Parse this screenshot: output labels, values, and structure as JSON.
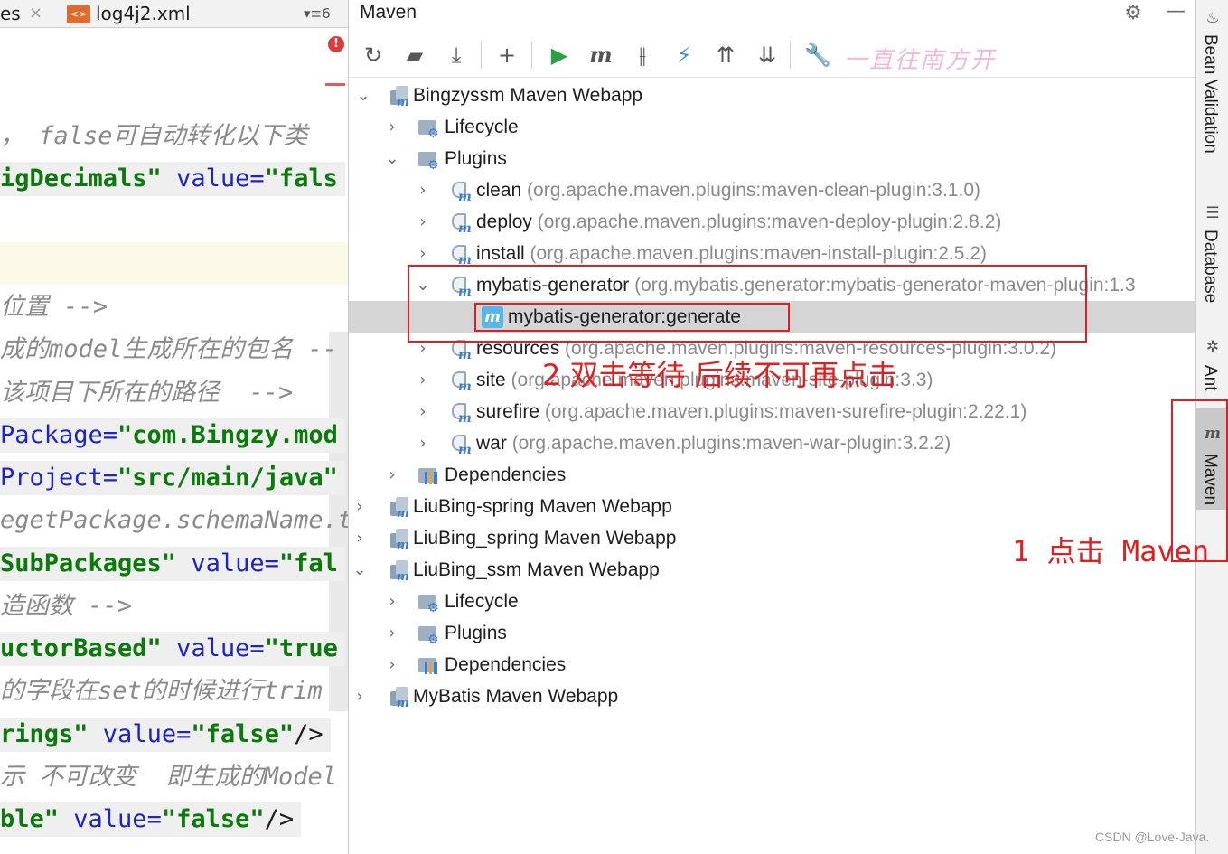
{
  "editor": {
    "tabs": [
      {
        "label": "es",
        "close": "×"
      },
      {
        "icon": "xml-file-icon",
        "icon_text": "<>",
        "label": "log4j2.xml"
      }
    ],
    "tab_overflow": "▾≡6",
    "code_lines": [
      {
        "type": "comment",
        "text": "， false可自动转化以下类"
      },
      {
        "parts": [
          "igDecimals\"",
          " value=",
          "\"fals"
        ]
      },
      {
        "type": "comment",
        "text": "位置 -->"
      },
      {
        "type": "comment",
        "text": "成的model生成所在的包名 --"
      },
      {
        "type": "comment",
        "text": "该项目下所在的路径  -->"
      },
      {
        "parts": [
          "Package=",
          "\"com.Bingzy.mod"
        ]
      },
      {
        "parts": [
          "Project=",
          "\"src/main/java\""
        ]
      },
      {
        "type": "comment",
        "text": "egetPackage.schemaName.t"
      },
      {
        "parts": [
          "SubPackages\"",
          " value=",
          "\"fal"
        ]
      },
      {
        "type": "comment",
        "text": "造函数 -->"
      },
      {
        "parts": [
          "uctorBased\"",
          " value=",
          "\"true"
        ]
      },
      {
        "type": "comment",
        "text": "的字段在set的时候进行trim"
      },
      {
        "parts": [
          "rings\"",
          " value=",
          "\"false\"",
          "/>"
        ]
      },
      {
        "type": "comment",
        "text": "示 不可改变  即生成的Model"
      },
      {
        "parts": [
          "ble\"",
          " value=",
          "\"false\"",
          "/>"
        ]
      }
    ]
  },
  "maven": {
    "title": "Maven",
    "watermark": "一直往南方开",
    "toolbar": [
      "reload-icon",
      "reimport-folder-icon",
      "download-icon",
      "add-icon",
      "run-icon",
      "maven-goal-icon",
      "toggle-offline-icon",
      "skip-tests-icon",
      "expand-all-icon",
      "collapse-all-icon",
      "wrench-icon"
    ],
    "tree": [
      {
        "id": "bingzyssm",
        "label": "Bingzyssm Maven Webapp",
        "icon": "project",
        "expanded": true
      },
      {
        "id": "lifecycle1",
        "label": "Lifecycle",
        "icon": "folder",
        "expanded": false
      },
      {
        "id": "plugins1",
        "label": "Plugins",
        "icon": "folder",
        "expanded": true
      },
      {
        "id": "clean",
        "label": "clean",
        "sub": "(org.apache.maven.plugins:maven-clean-plugin:3.1.0)",
        "icon": "plugin",
        "expanded": false
      },
      {
        "id": "deploy",
        "label": "deploy",
        "sub": "(org.apache.maven.plugins:maven-deploy-plugin:2.8.2)",
        "icon": "plugin",
        "expanded": false
      },
      {
        "id": "install",
        "label": "install",
        "sub": "(org.apache.maven.plugins:maven-install-plugin:2.5.2)",
        "icon": "plugin",
        "expanded": false
      },
      {
        "id": "mbg",
        "label": "mybatis-generator",
        "sub": "(org.mybatis.generator:mybatis-generator-maven-plugin:1.3",
        "icon": "plugin",
        "expanded": true
      },
      {
        "id": "mbg-goal",
        "label": "mybatis-generator:generate",
        "icon": "goal",
        "selected": true
      },
      {
        "id": "resources",
        "label": "resources",
        "sub": "(org.apache.maven.plugins:maven-resources-plugin:3.0.2)",
        "icon": "plugin",
        "expanded": false
      },
      {
        "id": "site",
        "label": "site",
        "sub": "(org.apache.maven.plugins:maven-site-plugin:3.3)",
        "icon": "plugin",
        "expanded": false
      },
      {
        "id": "surefire",
        "label": "surefire",
        "sub": "(org.apache.maven.plugins:maven-surefire-plugin:2.22.1)",
        "icon": "plugin",
        "expanded": false
      },
      {
        "id": "war",
        "label": "war",
        "sub": "(org.apache.maven.plugins:maven-war-plugin:3.2.2)",
        "icon": "plugin",
        "expanded": false
      },
      {
        "id": "deps1",
        "label": "Dependencies",
        "icon": "dependencies",
        "expanded": false
      },
      {
        "id": "liubing-spring",
        "label": "LiuBing-spring Maven Webapp",
        "icon": "project",
        "expanded": false
      },
      {
        "id": "liubing-spring2",
        "label": "LiuBing_spring Maven Webapp",
        "icon": "project",
        "expanded": false
      },
      {
        "id": "liubing-ssm",
        "label": "LiuBing_ssm Maven Webapp",
        "icon": "project",
        "expanded": true
      },
      {
        "id": "lifecycle2",
        "label": "Lifecycle",
        "icon": "folder",
        "expanded": false
      },
      {
        "id": "plugins2",
        "label": "Plugins",
        "icon": "folder",
        "expanded": false
      },
      {
        "id": "deps2",
        "label": "Dependencies",
        "icon": "dependencies",
        "expanded": false
      },
      {
        "id": "mybatis",
        "label": "MyBatis Maven Webapp",
        "icon": "project",
        "expanded": false
      }
    ]
  },
  "annotations": {
    "step2": "2 双击等待 后续不可再点击",
    "step1": "1 点击 Maven",
    "color": "#e02020"
  },
  "right_strip": {
    "items": [
      {
        "label": "Bean Validation",
        "icon": "bean-validation-icon"
      },
      {
        "label": "Database",
        "icon": "database-icon"
      },
      {
        "label": "Ant",
        "icon": "ant-icon"
      },
      {
        "label": "Maven",
        "icon": "maven-icon",
        "active": true
      }
    ]
  },
  "credit": "CSDN @Love-Java."
}
